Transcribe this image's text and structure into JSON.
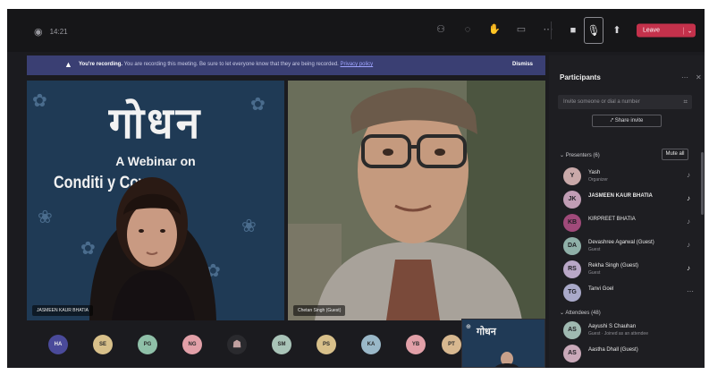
{
  "titlebar": {
    "timer": "14:21",
    "tools": [
      "people-icon",
      "chat-icon",
      "hand-icon",
      "rooms-icon",
      "more-icon"
    ],
    "leave_label": "Leave"
  },
  "banner": {
    "bold": "You're recording.",
    "text": "You are recording this meeting. Be sure to let everyone know that they are being recorded.",
    "link": "Privacy policy",
    "dismiss": "Dismiss"
  },
  "slide": {
    "title": "गोधन",
    "line1": "A Webinar on",
    "line2": "Conditi            y Cows"
  },
  "tiles": {
    "left_name": "JASMEEN KAUR BHATIA",
    "right_name": "Chetan Singh (Guest)"
  },
  "panel": {
    "title": "Participants",
    "invite_placeholder": "Invite someone or dial a number",
    "share_invite": "Share invite",
    "presenters_label": "Presenters (6)",
    "mute_all": "Mute all",
    "attendees_label": "Attendees (48)",
    "participants": [
      {
        "initials": "Y",
        "name": "Yash",
        "sub": "Organizer",
        "color": "#c9a9a9",
        "bold": false
      },
      {
        "initials": "JK",
        "name": "JASMEEN KAUR BHATIA",
        "sub": "",
        "color": "#c19db5",
        "bold": true
      },
      {
        "initials": "KB",
        "name": "KIRPREET BHATIA",
        "sub": "",
        "color": "#a04a7a",
        "bold": false
      },
      {
        "initials": "DA",
        "name": "Devashree Agarwal (Guest)",
        "sub": "Guest",
        "color": "#8fb0a8",
        "bold": false
      },
      {
        "initials": "RS",
        "name": "Rekha Singh (Guest)",
        "sub": "Guest",
        "color": "#b9a7c7",
        "bold": false
      },
      {
        "initials": "TG",
        "name": "Tanvi Goel",
        "sub": "",
        "color": "#a9a9c9",
        "bold": false
      }
    ],
    "attendees": [
      {
        "initials": "AS",
        "name": "Aayushi S Chauhan",
        "sub": "Guest · Joined as an attendee",
        "color": "#9fb9b1"
      },
      {
        "initials": "AS",
        "name": "Aastha Dhall (Guest)",
        "sub": "",
        "color": "#c9a9b9"
      }
    ]
  },
  "strip": [
    {
      "initials": "HA",
      "color": "#4a4a9a"
    },
    {
      "initials": "SE",
      "color": "#d8c08a"
    },
    {
      "initials": "PG",
      "color": "#8fc0a8"
    },
    {
      "initials": "NG",
      "color": "#e2a0a8"
    },
    {
      "initials": "",
      "color": "#7a6a6a"
    },
    {
      "initials": "SM",
      "color": "#a9c4b8"
    },
    {
      "initials": "PS",
      "color": "#d8c08a"
    },
    {
      "initials": "KA",
      "color": "#9ab8c8"
    },
    {
      "initials": "YB",
      "color": "#e2a0a8"
    },
    {
      "initials": "PT",
      "color": "#d8b890"
    }
  ],
  "thumb_title": "गोधन"
}
